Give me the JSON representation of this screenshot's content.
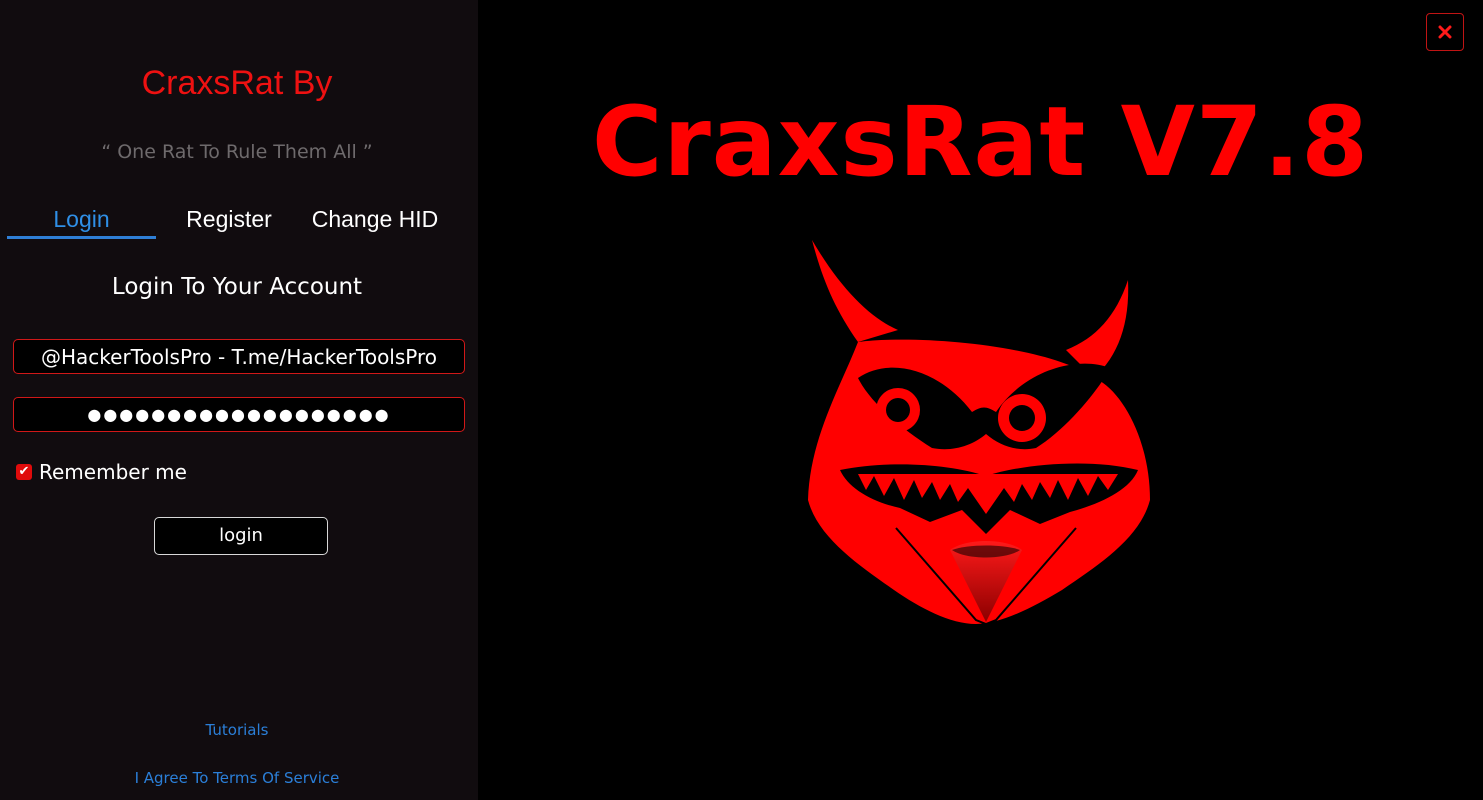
{
  "app": {
    "brand_title": "CraxsRat By",
    "tagline": "“ One Rat To Rule Them All ”",
    "hero_title": "CraxsRat V7.8"
  },
  "tabs": [
    {
      "label": "Login",
      "active": true
    },
    {
      "label": "Register",
      "active": false
    },
    {
      "label": "Change HID",
      "active": false
    }
  ],
  "form": {
    "heading": "Login To Your Account",
    "username_value": "@HackerToolsPro - T.me/HackerToolsPro",
    "password_value": "●●●●●●●●●●●●●●●●●●●",
    "remember_label": "Remember me",
    "remember_checked": true,
    "checkbox_glyph": "✔",
    "login_button": "login"
  },
  "links": {
    "tutorials": "Tutorials",
    "terms": "I Agree To Terms Of Service"
  },
  "icons": {
    "close": "close-icon",
    "logo": "devil-owl-logo"
  },
  "colors": {
    "accent_red": "#ff0000",
    "tab_active_blue": "#2f8fe6",
    "link_blue": "#2b7fd8",
    "panel_bg": "#110c0f"
  }
}
